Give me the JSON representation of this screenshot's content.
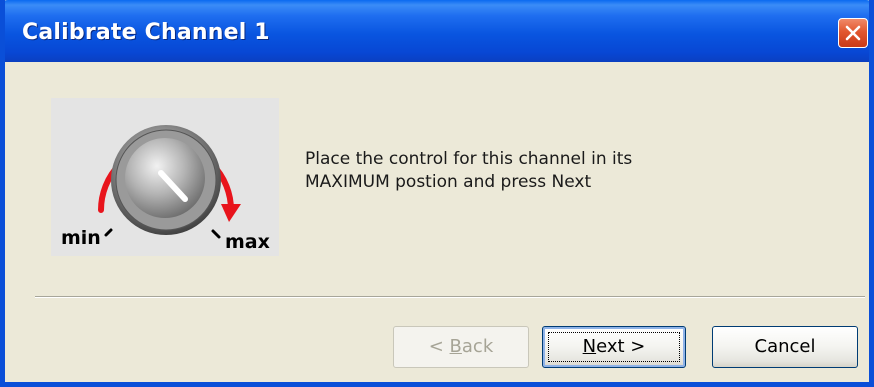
{
  "window": {
    "title": "Calibrate Channel 1"
  },
  "knob": {
    "min_label": "min",
    "max_label": "max"
  },
  "message": {
    "line1": "Place the control for this channel in its",
    "line2": "MAXIMUM postion and press Next"
  },
  "buttons": {
    "back_prefix": "< ",
    "back_mnemonic": "B",
    "back_rest": "ack",
    "next_mnemonic": "N",
    "next_rest": "ext >",
    "cancel": "Cancel"
  },
  "colors": {
    "titlebar": "#0955e0",
    "dialog_bg": "#ece9d8",
    "arrow": "#e8141c",
    "close_button": "#e2572f"
  },
  "icons": {
    "close": "close-x-icon",
    "knob": "rotary-knob-icon",
    "arrow": "clockwise-arrow-icon"
  }
}
